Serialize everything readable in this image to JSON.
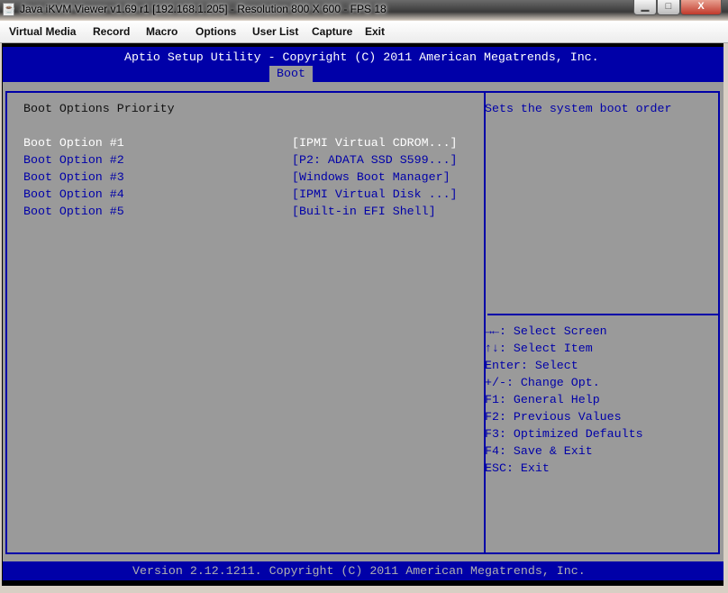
{
  "window": {
    "title": "Java iKVM Viewer v1.69 r1 [192.168.1.205] - Resolution 800 X 600 - FPS 18",
    "buttons": {
      "minimize": "▁",
      "maximize": "□",
      "close": "X"
    }
  },
  "menu": [
    "Virtual Media",
    "Record",
    "Macro",
    "Options",
    "User List",
    "Capture",
    "Exit"
  ],
  "bios": {
    "title": "Aptio Setup Utility - Copyright (C) 2011 American Megatrends, Inc.",
    "active_tab": "Boot",
    "section": "Boot Options Priority",
    "options": [
      {
        "label": "Boot Option #1",
        "value": "[IPMI Virtual CDROM...]"
      },
      {
        "label": "Boot Option #2",
        "value": "[P2: ADATA SSD S599...]"
      },
      {
        "label": "Boot Option #3",
        "value": "[Windows Boot Manager]"
      },
      {
        "label": "Boot Option #4",
        "value": "[IPMI Virtual Disk ...]"
      },
      {
        "label": "Boot Option #5",
        "value": "[Built-in EFI Shell]"
      }
    ],
    "help": "Sets the system boot order",
    "keys": [
      "→←: Select Screen",
      "↑↓: Select Item",
      "Enter: Select",
      "+/-: Change Opt.",
      "F1: General Help",
      "F2: Previous Values",
      "F3: Optimized Defaults",
      "F4: Save & Exit",
      "ESC: Exit"
    ],
    "footer": "Version 2.12.1211. Copyright (C) 2011 American Megatrends, Inc."
  },
  "colors": {
    "bios_blue": "#0000a8",
    "bios_gray": "#9a9a9a",
    "selected": "#ffffff"
  }
}
